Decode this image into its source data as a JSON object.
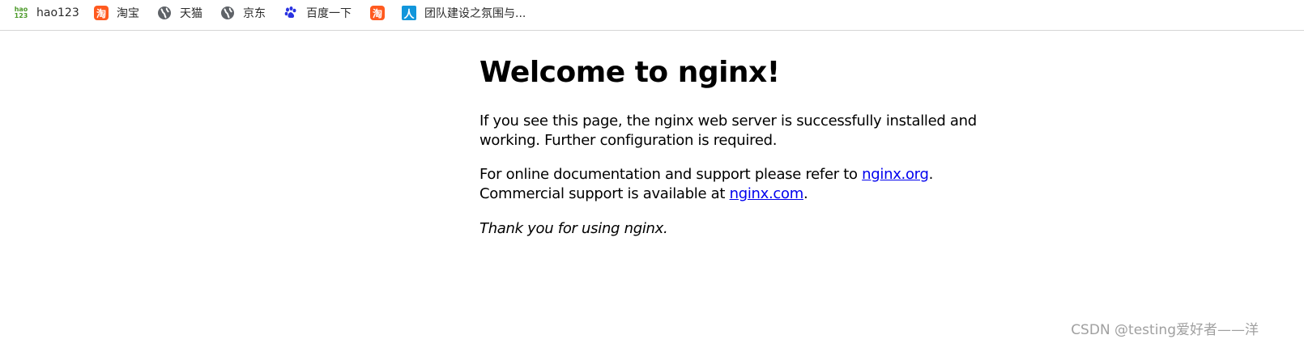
{
  "bookmarks": [
    {
      "label": "hao123",
      "icon": "hao123-icon"
    },
    {
      "label": "淘宝",
      "icon": "taobao-icon"
    },
    {
      "label": "天猫",
      "icon": "globe-icon"
    },
    {
      "label": "京东",
      "icon": "globe-icon"
    },
    {
      "label": "百度一下",
      "icon": "baidu-paw-icon"
    },
    {
      "label": "",
      "icon": "taobao-icon"
    },
    {
      "label": "团队建设之氛围与...",
      "icon": "ren-icon"
    }
  ],
  "icons": {
    "hao_top": "hao",
    "hao_bottom": "123",
    "tao_glyph": "淘",
    "baidu_glyph": "🐾",
    "ren_glyph": "人"
  },
  "page": {
    "heading": "Welcome to nginx!",
    "para1": "If you see this page, the nginx web server is successfully installed and working. Further configuration is required.",
    "para2_prefix": "For online documentation and support please refer to ",
    "link_org": "nginx.org",
    "para2_mid": ".",
    "para2_line2": "Commercial support is available at ",
    "link_com": "nginx.com",
    "para2_end": ".",
    "para3": "Thank you for using nginx."
  },
  "watermark": "CSDN @testing爱好者——洋",
  "colors": {
    "link": "#0000ee",
    "taobao": "#ff5a1f",
    "ren": "#1296db",
    "baidu": "#2932e1",
    "watermark": "#a0a0a0"
  }
}
